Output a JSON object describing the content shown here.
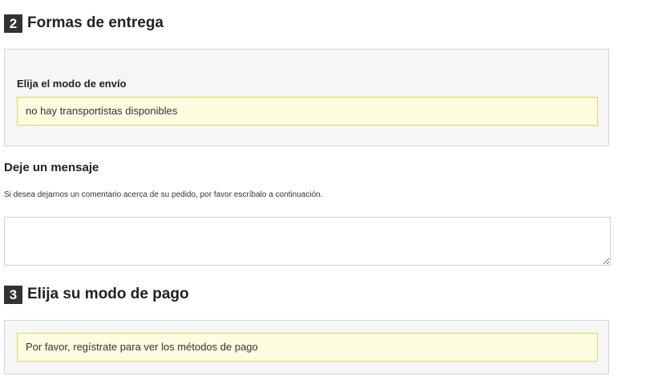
{
  "delivery": {
    "step_number": "2",
    "title": "Formas de entrega",
    "carrier_label": "Elija el modo de envío",
    "carrier_notice": "no hay transportistas disponibles"
  },
  "message": {
    "title": "Deje un mensaje",
    "hint": "Si desea dejarnos un comentario acerca de su pedido, por favor escríbalo a continuación.",
    "value": "",
    "placeholder": ""
  },
  "payment": {
    "step_number": "3",
    "title": "Elija su modo de pago",
    "notice": "Por favor, regístrate para ver los métodos de pago"
  }
}
